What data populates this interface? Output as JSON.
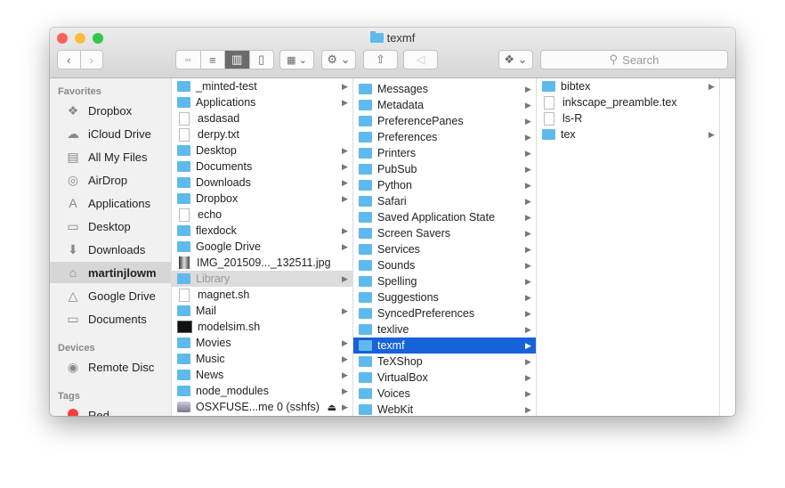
{
  "window": {
    "title": "texmf",
    "colors": {
      "close": "#fc605b",
      "minimize": "#fdbc40",
      "zoom": "#34c84a",
      "selection": "#1662d9",
      "folder": "#5fb9ec"
    }
  },
  "toolbar": {
    "back": "‹",
    "forward": "›",
    "view_icons": "▫▫",
    "view_list": "≡",
    "view_columns": "▥",
    "view_coverflow": "▯",
    "arrange": "▦ ⌄",
    "action": "⚙ ⌄",
    "share": "⇧",
    "tag": "◁",
    "dropbox": "❖ ⌄",
    "search_placeholder": "Search"
  },
  "sidebar": {
    "favorites_label": "Favorites",
    "favorites": [
      {
        "label": "Dropbox",
        "icon": "dropbox-icon",
        "glyph": "❖"
      },
      {
        "label": "iCloud Drive",
        "icon": "cloud-icon",
        "glyph": "☁"
      },
      {
        "label": "All My Files",
        "icon": "all-files-icon",
        "glyph": "▤"
      },
      {
        "label": "AirDrop",
        "icon": "airdrop-icon",
        "glyph": "◎"
      },
      {
        "label": "Applications",
        "icon": "applications-icon",
        "glyph": "A"
      },
      {
        "label": "Desktop",
        "icon": "desktop-icon",
        "glyph": "▭"
      },
      {
        "label": "Downloads",
        "icon": "downloads-icon",
        "glyph": "⬇"
      },
      {
        "label": "martinjlowm",
        "icon": "home-icon",
        "glyph": "⌂",
        "selected": true
      },
      {
        "label": "Google Drive",
        "icon": "google-drive-icon",
        "glyph": "△"
      },
      {
        "label": "Documents",
        "icon": "folder-icon",
        "glyph": "▭"
      }
    ],
    "devices_label": "Devices",
    "devices": [
      {
        "label": "Remote Disc",
        "icon": "disc-icon",
        "glyph": "◉"
      }
    ],
    "tags_label": "Tags",
    "tags": [
      {
        "label": "Red",
        "color": "#fc3d39"
      }
    ]
  },
  "columns": [
    [
      {
        "name": "_minted-test",
        "folder": true,
        "arrow": true
      },
      {
        "name": "Applications",
        "folder": true,
        "arrow": true
      },
      {
        "name": "asdasad"
      },
      {
        "name": "derpy.txt"
      },
      {
        "name": "Desktop",
        "folder": true,
        "arrow": true
      },
      {
        "name": "Documents",
        "folder": true,
        "arrow": true
      },
      {
        "name": "Downloads",
        "folder": true,
        "arrow": true
      },
      {
        "name": "Dropbox",
        "folder": true,
        "arrow": true
      },
      {
        "name": "echo"
      },
      {
        "name": "flexdock",
        "folder": true,
        "arrow": true
      },
      {
        "name": "Google Drive",
        "folder": true,
        "arrow": true
      },
      {
        "name": "IMG_201509..._132511.jpg",
        "image": true
      },
      {
        "name": "Library",
        "folder": true,
        "arrow": true,
        "state": "path"
      },
      {
        "name": "magnet.sh"
      },
      {
        "name": "Mail",
        "folder": true,
        "arrow": true
      },
      {
        "name": "modelsim.sh",
        "terminal": true
      },
      {
        "name": "Movies",
        "folder": true,
        "arrow": true
      },
      {
        "name": "Music",
        "folder": true,
        "arrow": true
      },
      {
        "name": "News",
        "folder": true,
        "arrow": true
      },
      {
        "name": "node_modules",
        "folder": true,
        "arrow": true
      },
      {
        "name": "OSXFUSE...me 0 (sshfs)",
        "drive": true,
        "arrow": true,
        "eject": "⏏"
      }
    ],
    [
      {
        "name": "Messages",
        "folder": true,
        "arrow": true
      },
      {
        "name": "Metadata",
        "folder": true,
        "arrow": true
      },
      {
        "name": "PreferencePanes",
        "folder": true,
        "arrow": true
      },
      {
        "name": "Preferences",
        "folder": true,
        "arrow": true
      },
      {
        "name": "Printers",
        "folder": true,
        "arrow": true
      },
      {
        "name": "PubSub",
        "folder": true,
        "arrow": true
      },
      {
        "name": "Python",
        "folder": true,
        "arrow": true
      },
      {
        "name": "Safari",
        "folder": true,
        "arrow": true
      },
      {
        "name": "Saved Application State",
        "folder": true,
        "arrow": true
      },
      {
        "name": "Screen Savers",
        "folder": true,
        "arrow": true
      },
      {
        "name": "Services",
        "folder": true,
        "arrow": true
      },
      {
        "name": "Sounds",
        "folder": true,
        "arrow": true
      },
      {
        "name": "Spelling",
        "folder": true,
        "arrow": true
      },
      {
        "name": "Suggestions",
        "folder": true,
        "arrow": true
      },
      {
        "name": "SyncedPreferences",
        "folder": true,
        "arrow": true
      },
      {
        "name": "texlive",
        "folder": true,
        "arrow": true
      },
      {
        "name": "texmf",
        "folder": true,
        "arrow": true,
        "state": "selected"
      },
      {
        "name": "TeXShop",
        "folder": true,
        "arrow": true
      },
      {
        "name": "VirtualBox",
        "folder": true,
        "arrow": true
      },
      {
        "name": "Voices",
        "folder": true,
        "arrow": true
      },
      {
        "name": "WebKit",
        "folder": true,
        "arrow": true
      }
    ],
    [
      {
        "name": "bibtex",
        "folder": true,
        "arrow": true
      },
      {
        "name": "inkscape_preamble.tex"
      },
      {
        "name": "ls-R"
      },
      {
        "name": "tex",
        "folder": true,
        "arrow": true
      }
    ]
  ]
}
